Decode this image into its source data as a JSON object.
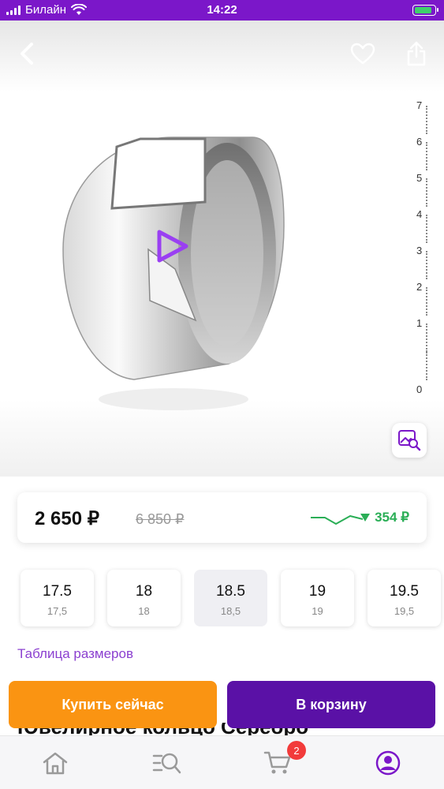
{
  "status_bar": {
    "carrier": "Билайн",
    "time": "14:22",
    "battery_level": 0.85
  },
  "nav": {
    "back_icon": "chevron-left-icon",
    "favorite_icon": "heart-icon",
    "share_icon": "share-icon"
  },
  "gallery": {
    "scale_labels": [
      "7",
      "6",
      "5",
      "4",
      "3",
      "2",
      "1",
      "0"
    ],
    "zoom_icon": "image-search-icon",
    "play_icon": "play-icon"
  },
  "price": {
    "current": "2 650 ₽",
    "old": "6 850 ₽",
    "drop": "354 ₽",
    "trend_color": "#2aae56"
  },
  "sizes": [
    {
      "label": "17.5",
      "sub": "17,5",
      "selected": false
    },
    {
      "label": "18",
      "sub": "18",
      "selected": false
    },
    {
      "label": "18.5",
      "sub": "18,5",
      "selected": true
    },
    {
      "label": "19",
      "sub": "19",
      "selected": false
    },
    {
      "label": "19.5",
      "sub": "19,5",
      "selected": false
    }
  ],
  "size_table_link": "Таблица размеров",
  "actions": {
    "buy_now": "Купить сейчас",
    "add_to_cart": "В корзину"
  },
  "product_title": "Ювелирное кольцо Серебро",
  "tabbar": {
    "cart_badge": "2"
  },
  "colors": {
    "brand": "#7b17c9",
    "buy": "#fa9412",
    "cart": "#5a11a6"
  }
}
